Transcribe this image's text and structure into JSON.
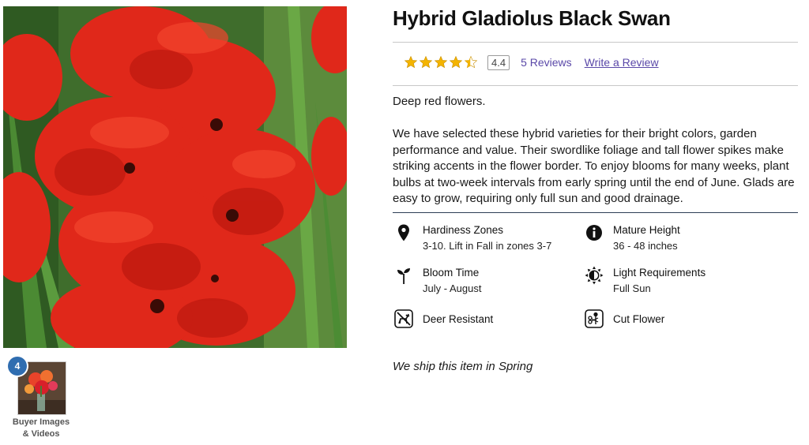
{
  "product": {
    "title": "Hybrid Gladiolus Black Swan",
    "rating": {
      "stars": 4.4,
      "score_text": "4.4",
      "reviews_label": "5 Reviews",
      "write_review_label": "Write a Review",
      "star_color": "#f4b400"
    },
    "short_description": "Deep red flowers.",
    "long_description": "We have selected these hybrid varieties for their bright colors, garden performance and value. Their swordlike foliage and tall flower spikes make striking accents in the flower border. To enjoy blooms for many weeks, plant bulbs at two-week intervals from early spring until the end of June. Glads are easy to grow, requiring only full sun and good drainage.",
    "attributes": [
      {
        "icon": "location-pin-icon",
        "title": "Hardiness Zones",
        "value": "3-10. Lift in Fall in zones 3-7"
      },
      {
        "icon": "info-icon",
        "title": "Mature Height",
        "value": "36 - 48 inches"
      },
      {
        "icon": "sprout-icon",
        "title": "Bloom Time",
        "value": "July - August"
      },
      {
        "icon": "sun-icon",
        "title": "Light Requirements",
        "value": "Full Sun"
      },
      {
        "icon": "deer-resistant-icon",
        "title": "Deer Resistant",
        "value": ""
      },
      {
        "icon": "cut-flower-icon",
        "title": "Cut Flower",
        "value": ""
      }
    ],
    "shipping_note": "We ship this item in Spring"
  },
  "gallery": {
    "buyer_media_count": "4",
    "buyer_media_label_line1": "Buyer Images",
    "buyer_media_label_line2": "& Videos"
  },
  "colors": {
    "link": "#5a48a8",
    "badge": "#2f6db0",
    "divider_dark": "#2c3e55"
  }
}
